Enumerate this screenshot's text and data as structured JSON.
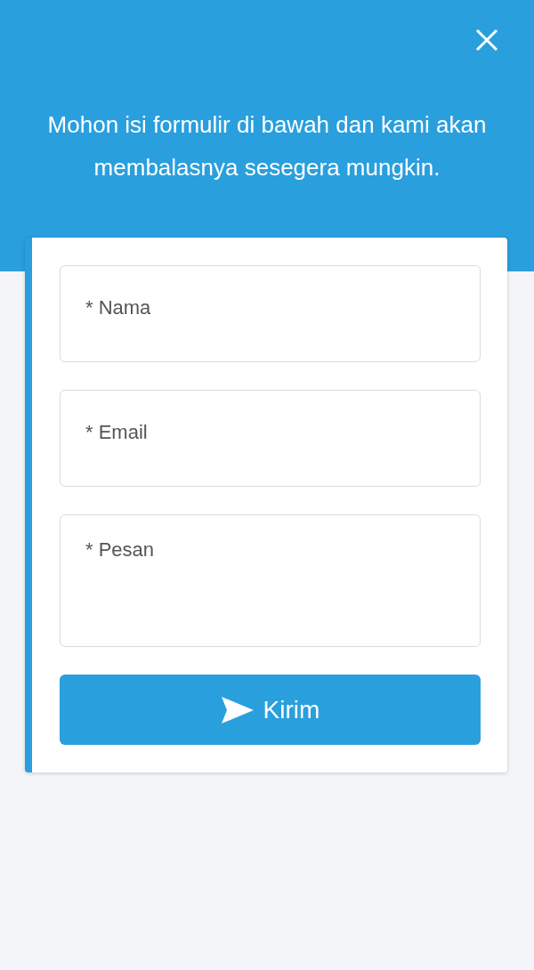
{
  "header": {
    "message": "Mohon isi formulir di bawah dan kami akan membalasnya sesegera mungkin."
  },
  "fields": [
    {
      "kind": "input",
      "placeholder": "* Nama"
    },
    {
      "kind": "input",
      "placeholder": "* Email"
    },
    {
      "kind": "textarea",
      "placeholder": "* Pesan"
    }
  ],
  "submit_button": {
    "label": "Kirim"
  }
}
